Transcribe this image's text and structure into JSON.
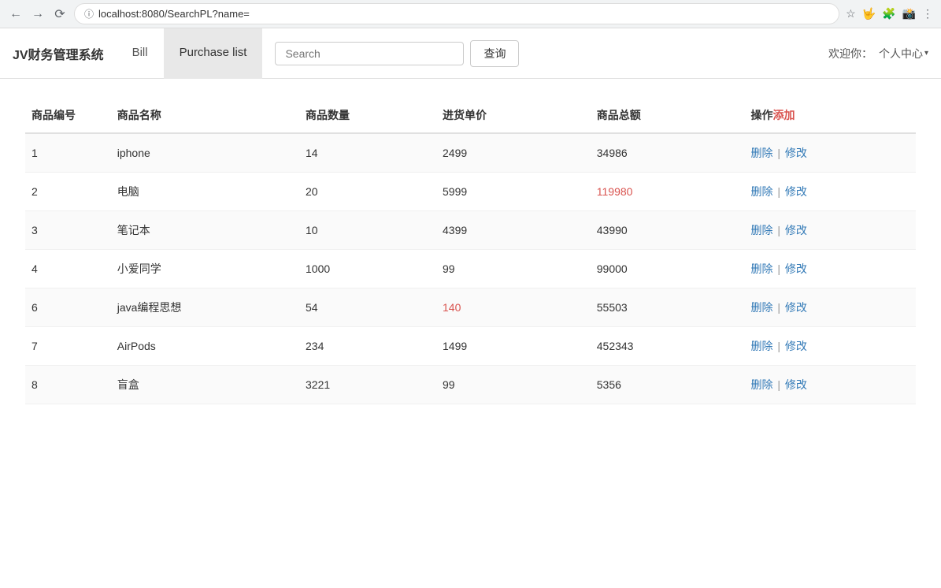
{
  "browser": {
    "url": "localhost:8080/SearchPL?name=",
    "back_label": "←",
    "forward_label": "→",
    "refresh_label": "↻"
  },
  "navbar": {
    "brand": "JV财务管理系统",
    "items": [
      {
        "label": "Bill",
        "active": false
      },
      {
        "label": "Purchase list",
        "active": true
      }
    ],
    "search_placeholder": "Search",
    "search_btn_label": "查询",
    "welcome_label": "欢迎你：",
    "profile_label": "个人中心",
    "profile_chevron": "▾"
  },
  "table": {
    "columns": [
      {
        "key": "id",
        "label": "商品编号"
      },
      {
        "key": "name",
        "label": "商品名称"
      },
      {
        "key": "qty",
        "label": "商品数量"
      },
      {
        "key": "unit_price",
        "label": "进货单价"
      },
      {
        "key": "total",
        "label": "商品总额"
      },
      {
        "key": "action",
        "label": "操作"
      }
    ],
    "action_add_label": "添加",
    "action_delete_label": "删除",
    "action_edit_label": "修改",
    "action_separator": "|",
    "rows": [
      {
        "id": "1",
        "name": "iphone",
        "qty": "14",
        "unit_price": "2499",
        "total": "34986",
        "total_highlight": false
      },
      {
        "id": "2",
        "name": "电脑",
        "qty": "20",
        "unit_price": "5999",
        "total": "119980",
        "total_highlight": true
      },
      {
        "id": "3",
        "name": "笔记本",
        "qty": "10",
        "unit_price": "4399",
        "total": "43990",
        "total_highlight": false
      },
      {
        "id": "4",
        "name": "小爱同学",
        "qty": "1000",
        "unit_price": "99",
        "total": "99000",
        "total_highlight": false
      },
      {
        "id": "6",
        "name": "java编程思想",
        "qty": "54",
        "unit_price": "140",
        "total": "55503",
        "price_highlight": true
      },
      {
        "id": "7",
        "name": "AirPods",
        "qty": "234",
        "unit_price": "1499",
        "total": "452343",
        "total_highlight": false
      },
      {
        "id": "8",
        "name": "盲盒",
        "qty": "3221",
        "unit_price": "99",
        "total": "5356",
        "total_highlight": false
      }
    ]
  }
}
